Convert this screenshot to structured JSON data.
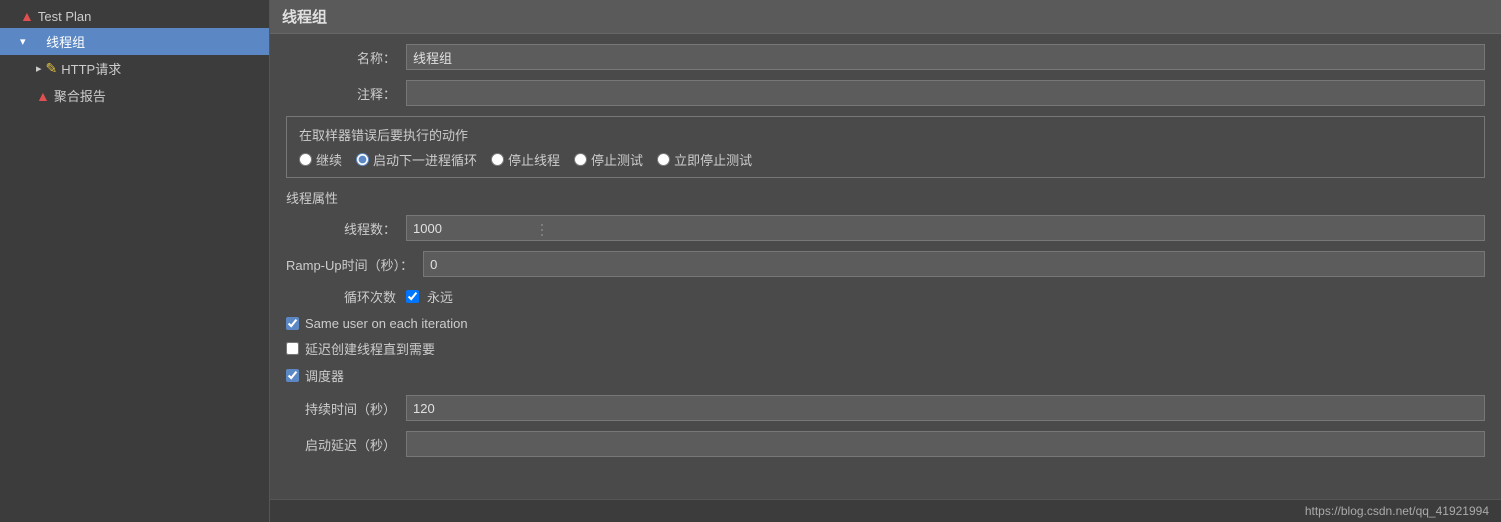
{
  "sidebar": {
    "items": [
      {
        "id": "test-plan",
        "label": "Test Plan",
        "indent": 0,
        "icon": "▲",
        "iconClass": "icon-testplan",
        "arrow": "",
        "active": false
      },
      {
        "id": "thread-group",
        "label": "线程组",
        "indent": 1,
        "icon": "⚙",
        "iconClass": "icon-thread",
        "arrow": "▾",
        "active": true
      },
      {
        "id": "http-request",
        "label": "HTTP请求",
        "indent": 2,
        "icon": "✎",
        "iconClass": "icon-http",
        "arrow": "▸",
        "active": false
      },
      {
        "id": "aggregate-report",
        "label": "聚合报告",
        "indent": 2,
        "icon": "▲",
        "iconClass": "icon-report",
        "arrow": "",
        "active": false
      }
    ]
  },
  "main": {
    "page_title": "线程组",
    "name_label": "名称：",
    "name_value": "线程组",
    "comment_label": "注释：",
    "comment_value": "",
    "error_section_title": "在取样器错误后要执行的动作",
    "error_options": [
      {
        "id": "continue",
        "label": "继续",
        "checked": false
      },
      {
        "id": "start-next",
        "label": "启动下一进程循环",
        "checked": true
      },
      {
        "id": "stop-thread",
        "label": "停止线程",
        "checked": false
      },
      {
        "id": "stop-test",
        "label": "停止测试",
        "checked": false
      },
      {
        "id": "stop-test-now",
        "label": "立即停止测试",
        "checked": false
      }
    ],
    "thread_props_title": "线程属性",
    "thread_count_label": "线程数：",
    "thread_count_value": "1000",
    "ramp_up_label": "Ramp-Up时间（秒）：",
    "ramp_up_value": "0",
    "loop_label": "循环次数",
    "forever_label": "永远",
    "forever_checked": true,
    "same_user_label": "Same user on each iteration",
    "same_user_checked": true,
    "delay_thread_label": "延迟创建线程直到需要",
    "delay_thread_checked": false,
    "scheduler_label": "调度器",
    "scheduler_checked": true,
    "duration_label": "持续时间（秒）",
    "duration_value": "120",
    "startup_delay_label": "启动延迟（秒）",
    "startup_delay_value": "",
    "bottom_url": "https://blog.csdn.net/qq_41921994"
  }
}
